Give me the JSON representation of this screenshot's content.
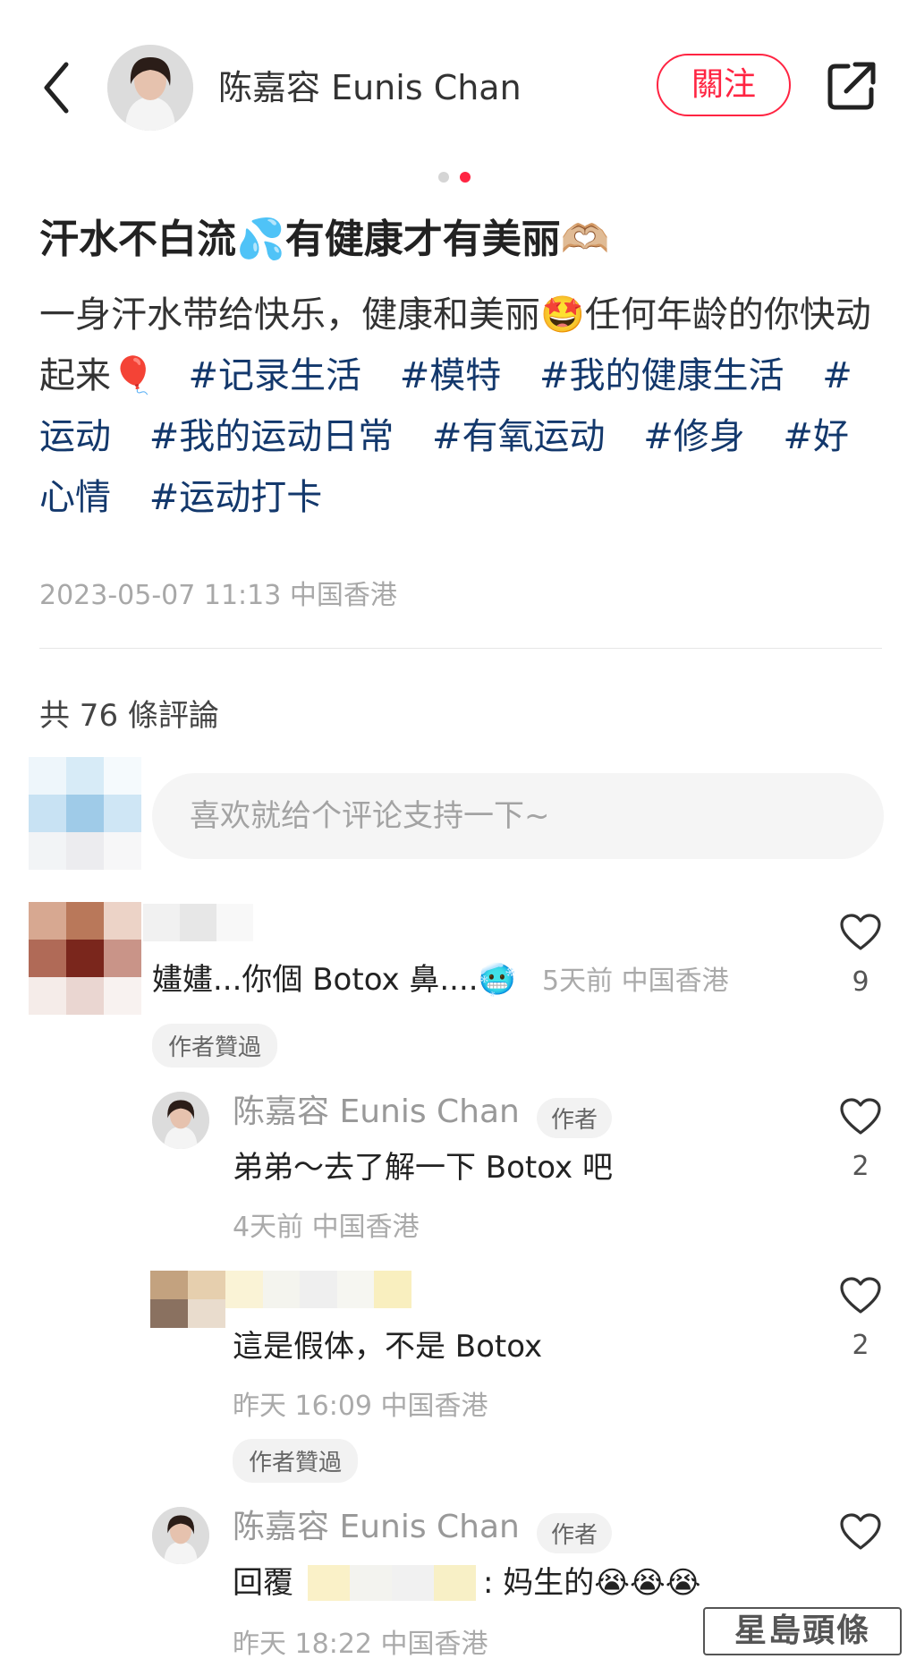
{
  "header": {
    "author_name": "陈嘉容 Eunis Chan",
    "follow_label": "關注"
  },
  "post": {
    "title": "汗水不白流💦有健康才有美丽🫶🏼",
    "body_text": "一身汗水带给快乐，健康和美丽🤩任何年龄的你快动起来🎈",
    "hashtags": [
      "#记录生活",
      "#模特",
      "#我的健康生活",
      "#运动",
      "#我的运动日常",
      "#有氧运动",
      "#修身",
      "#好心情",
      "#运动打卡"
    ],
    "date_location": "2023-05-07 11:13 中国香港"
  },
  "comments_section": {
    "count_label": "共 76 條評論",
    "input_placeholder": "喜欢就给个评论支持一下~"
  },
  "comments": [
    {
      "text": "嫿嫿...你個 Botox 鼻....🥶",
      "meta": "5天前 中国香港",
      "likes": "9",
      "liked_by_author": "作者贊過"
    },
    {
      "name": "陈嘉容 Eunis Chan",
      "badge": "作者",
      "text": "弟弟～去了解一下 Botox 吧",
      "meta": "4天前 中国香港",
      "likes": "2"
    },
    {
      "text": "這是假体，不是 Botox",
      "meta": "昨天 16:09 中国香港",
      "likes": "2",
      "liked_by_author": "作者贊過"
    },
    {
      "name": "陈嘉容 Eunis Chan",
      "badge": "作者",
      "reply_prefix": "回覆",
      "text": ": 妈生的😭😭😭",
      "meta": "昨天 18:22 中国香港",
      "likes": ""
    }
  ],
  "watermark": "星島頭條",
  "colors": {
    "accent": "#ff2442",
    "hashtag": "#13386c"
  }
}
